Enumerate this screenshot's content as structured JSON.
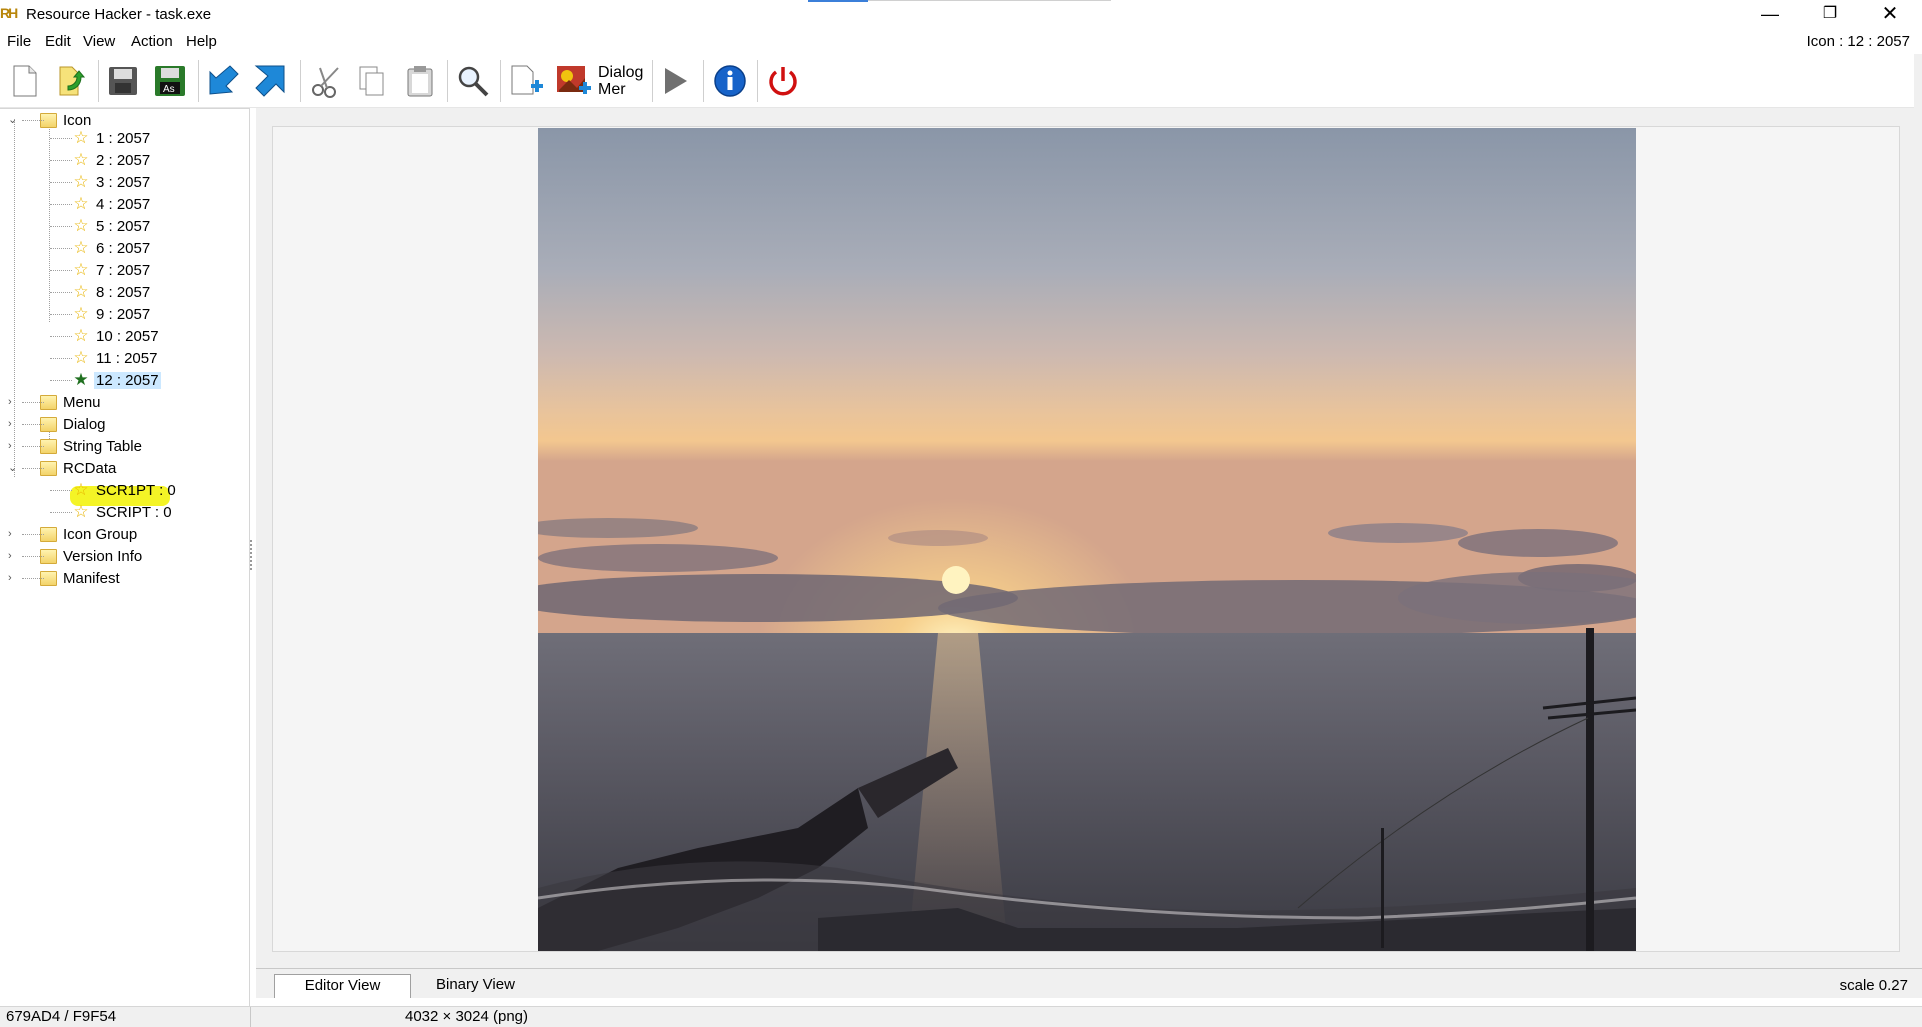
{
  "window": {
    "title": "Resource Hacker - task.exe",
    "app_icon_text": "RH",
    "min_glyph": "—",
    "restore_glyph": "❐",
    "close_glyph": "✕"
  },
  "menu": {
    "items": [
      "File",
      "Edit",
      "View",
      "Action",
      "Help"
    ],
    "resource_label": "Icon : 12 : 2057"
  },
  "toolbar": {
    "dialog_merge_label_1": "Dialog",
    "dialog_merge_label_2": "Mer",
    "saveas_label": "As"
  },
  "tree": {
    "icon_folder": "Icon",
    "icon_items": [
      "1 : 2057",
      "2 : 2057",
      "3 : 2057",
      "4 : 2057",
      "5 : 2057",
      "6 : 2057",
      "7 : 2057",
      "8 : 2057",
      "9 : 2057",
      "10 : 2057",
      "11 : 2057",
      "12 : 2057"
    ],
    "menu_folder": "Menu",
    "dialog_folder": "Dialog",
    "string_table_folder": "String Table",
    "rcdata_folder": "RCData",
    "rcdata_items": [
      "SCR1PT : 0",
      "SCRIPT : 0"
    ],
    "icon_group_folder": "Icon Group",
    "version_info_folder": "Version Info",
    "manifest_folder": "Manifest",
    "selected_item": "12 : 2057"
  },
  "tabs": {
    "editor_view": "Editor View",
    "binary_view": "Binary View",
    "scale": "scale 0.27"
  },
  "status": {
    "position": "679AD4 / F9F54",
    "image_info": "4032 × 3024 (png)"
  },
  "colors": {
    "selection": "#cce8ff",
    "highlight": "#f2f200",
    "accent": "#3b7fd9"
  }
}
